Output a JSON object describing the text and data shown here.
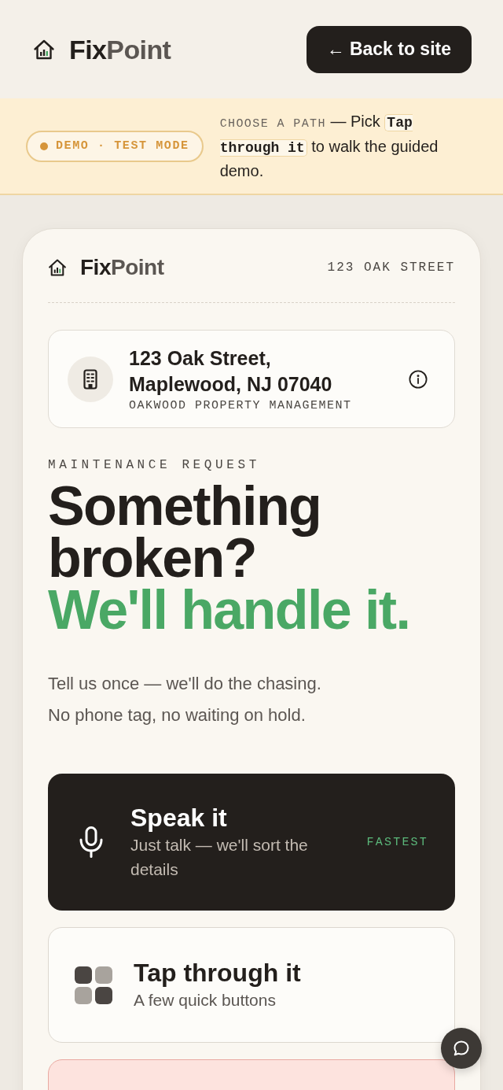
{
  "header": {
    "logo": {
      "primary": "Fix",
      "secondary": "Point"
    },
    "back_button": "← Back to site"
  },
  "demo_banner": {
    "badge": "DEMO · TEST MODE",
    "label": "CHOOSE A PATH",
    "text": "— Pick **Tap through it** to walk the guided demo."
  },
  "card": {
    "logo": {
      "primary": "Fix",
      "secondary": "Point"
    },
    "address_short": "123 OAK STREET",
    "property": {
      "address": "123 Oak Street, Maplewood, NJ 07040",
      "manager": "OAKWOOD PROPERTY MANAGEMENT"
    },
    "eyebrow": "MAINTENANCE REQUEST",
    "headline": "Something broken?",
    "headline_accent": "We'll handle it.",
    "subtitle_lines": [
      "Tell us once — we'll do the chasing.",
      "No phone tag, no waiting on hold."
    ],
    "options": [
      {
        "kind": "voice",
        "title": "Speak it",
        "description": "Just talk — we'll sort the details",
        "badge": "FASTEST"
      },
      {
        "kind": "tap",
        "title": "Tap through it",
        "description": "A few quick buttons"
      },
      {
        "kind": "alert"
      }
    ]
  }
}
